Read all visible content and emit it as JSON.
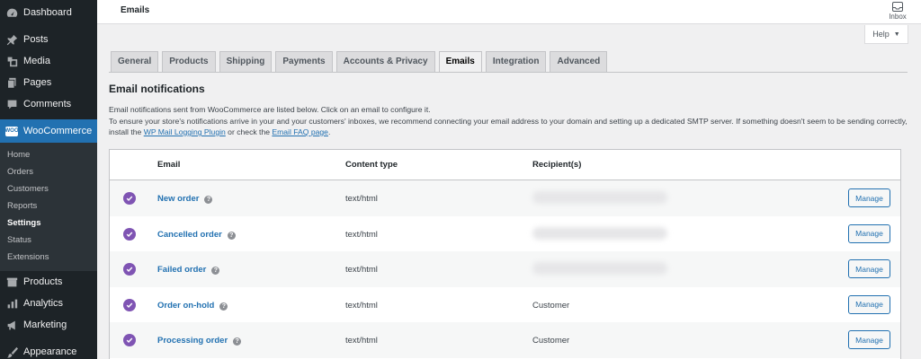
{
  "sidebar": {
    "items": [
      {
        "label": "Dashboard",
        "icon": "dashboard-icon"
      },
      {
        "label": "Posts",
        "icon": "pin-icon"
      },
      {
        "label": "Media",
        "icon": "media-icon"
      },
      {
        "label": "Pages",
        "icon": "pages-icon"
      },
      {
        "label": "Comments",
        "icon": "comment-icon"
      },
      {
        "label": "WooCommerce",
        "icon": "woocommerce-icon"
      }
    ],
    "woocommerce_badge": "WOO",
    "submenu": [
      "Home",
      "Orders",
      "Customers",
      "Reports",
      "Settings",
      "Status",
      "Extensions"
    ],
    "lower_items": [
      {
        "label": "Products",
        "icon": "products-icon"
      },
      {
        "label": "Analytics",
        "icon": "analytics-icon"
      },
      {
        "label": "Marketing",
        "icon": "megaphone-icon"
      },
      {
        "label": "Appearance",
        "icon": "brush-icon"
      }
    ]
  },
  "header": {
    "title": "Emails",
    "inbox_label": "Inbox",
    "help_label": "Help"
  },
  "tabs": [
    "General",
    "Products",
    "Shipping",
    "Payments",
    "Accounts & Privacy",
    "Emails",
    "Integration",
    "Advanced"
  ],
  "active_tab": "Emails",
  "section": {
    "title": "Email notifications",
    "line1": "Email notifications sent from WooCommerce are listed below. Click on an email to configure it.",
    "line2_a": "To ensure your store's notifications arrive in your and your customers' inboxes, we recommend connecting your email address to your domain and setting up a dedicated SMTP server. If something doesn't seem to be sending correctly, install the ",
    "link1": "WP Mail Logging Plugin",
    "line2_b": " or check the ",
    "link2": "Email FAQ page",
    "line2_c": "."
  },
  "table": {
    "headers": {
      "email": "Email",
      "content_type": "Content type",
      "recipients": "Recipient(s)"
    },
    "rows": [
      {
        "name": "New order",
        "content_type": "text/html",
        "recipient": "",
        "manage": "Manage"
      },
      {
        "name": "Cancelled order",
        "content_type": "text/html",
        "recipient": "",
        "manage": "Manage"
      },
      {
        "name": "Failed order",
        "content_type": "text/html",
        "recipient": "",
        "manage": "Manage"
      },
      {
        "name": "Order on-hold",
        "content_type": "text/html",
        "recipient": "Customer",
        "manage": "Manage"
      },
      {
        "name": "Processing order",
        "content_type": "text/html",
        "recipient": "Customer",
        "manage": "Manage"
      }
    ]
  },
  "colors": {
    "accent": "#2271b1",
    "check": "#7f54b3",
    "sidebar": "#1d2327"
  }
}
